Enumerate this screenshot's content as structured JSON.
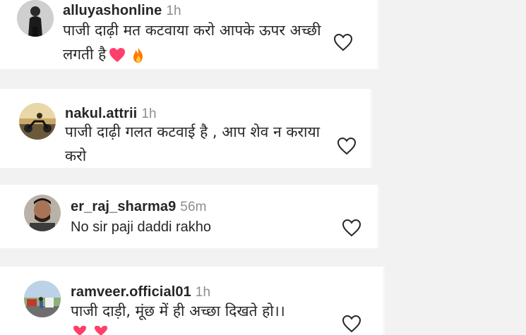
{
  "comments": [
    {
      "username": "alluyashonline",
      "time": "1h",
      "text": "पाजी दाढ़ी मत कटवाया करो आपके ऊपर अच्छी लगती है",
      "emojis": [
        "pink-heart-emoji",
        "fire-emoji"
      ]
    },
    {
      "username": "nakul.attrii",
      "time": "1h",
      "text": "पाजी दाढ़ी गलत कटवाई है , आप शेव न कराया करो"
    },
    {
      "username": "er_raj_sharma9",
      "time": "56m",
      "text": "No sir paji daddi rakho"
    },
    {
      "username": "ramveer.official01",
      "time": "1h",
      "text": "पाजी दाड़ी, मूंछ में ही अच्छा दिखते हो।।"
    }
  ],
  "icons": {
    "like": "heart-outline-icon",
    "accent_pink": "#ff3e6c",
    "accent_fire": "#ff7a00"
  }
}
